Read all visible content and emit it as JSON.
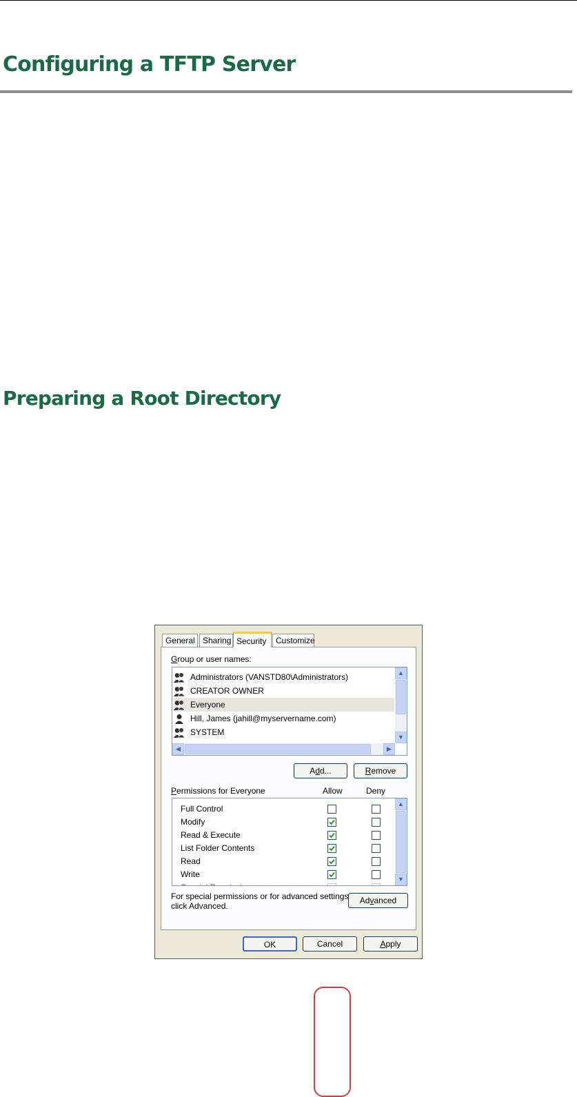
{
  "page": {
    "heading": "Configuring a TFTP Server",
    "subheading": "Preparing a Root Directory"
  },
  "dialog": {
    "tabs": [
      {
        "label": "General",
        "active": false
      },
      {
        "label": "Sharing",
        "active": false
      },
      {
        "label": "Security",
        "active": true
      },
      {
        "label": "Customize",
        "active": false
      }
    ],
    "group_label_mnemonic": "G",
    "group_label_rest": "roup or user names:",
    "users": [
      {
        "name": "Administrators (VANSTD80\\Administrators)",
        "icon": "group-icon",
        "selected": false
      },
      {
        "name": "CREATOR OWNER",
        "icon": "group-icon",
        "selected": false
      },
      {
        "name": "Everyone",
        "icon": "group-icon",
        "selected": true
      },
      {
        "name": "Hill, James (jahill@myservername.com)",
        "icon": "user-icon",
        "selected": false
      },
      {
        "name": "SYSTEM",
        "icon": "group-icon",
        "selected": false
      }
    ],
    "add_button_pre": "A",
    "add_button_mnemonic": "d",
    "add_button_post": "d...",
    "remove_button_mnemonic": "R",
    "remove_button_rest": "emove",
    "permissions_label_mnemonic": "P",
    "permissions_label_rest": "ermissions for Everyone",
    "allow_header": "Allow",
    "deny_header": "Deny",
    "permissions": [
      {
        "name": "Full Control",
        "allow": false,
        "deny": false
      },
      {
        "name": "Modify",
        "allow": true,
        "deny": false
      },
      {
        "name": "Read & Execute",
        "allow": true,
        "deny": false
      },
      {
        "name": "List Folder Contents",
        "allow": true,
        "deny": false
      },
      {
        "name": "Read",
        "allow": true,
        "deny": false
      },
      {
        "name": "Write",
        "allow": true,
        "deny": false
      },
      {
        "name": "Special Permissions",
        "allow": false,
        "deny": false
      }
    ],
    "advanced_text_line1": "For special permissions or for advanced settings,",
    "advanced_text_line2": "click Advanced.",
    "advanced_button_pre": "Ad",
    "advanced_button_mnemonic": "v",
    "advanced_button_post": "anced",
    "ok_button": "OK",
    "cancel_button": "Cancel",
    "apply_button_mnemonic": "A",
    "apply_button_rest": "pply",
    "colors": {
      "heading": "#1a6a46",
      "highlight_ring": "#e0383e",
      "active_tab_accent": "#ffc83c",
      "check": "#21a121"
    }
  }
}
